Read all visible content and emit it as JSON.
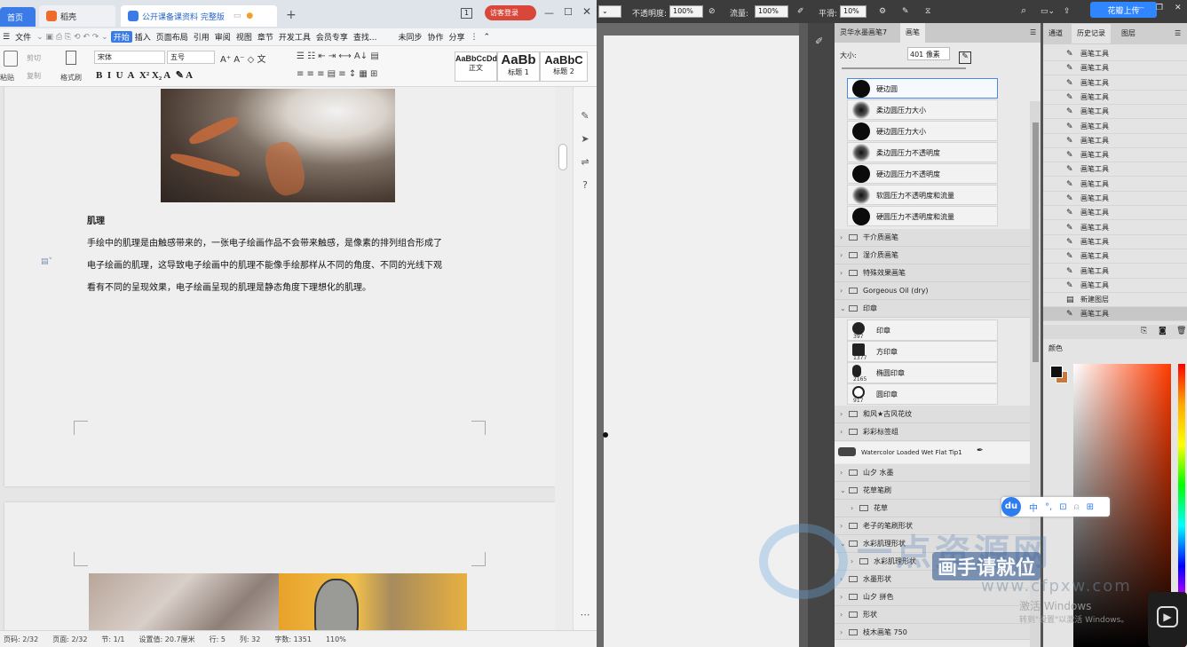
{
  "wps": {
    "tabs": [
      {
        "label": "首页"
      },
      {
        "label": "稻壳"
      },
      {
        "label": "公开课备课资料 完整版"
      }
    ],
    "page_indicator": "1",
    "login_label": "访客登录",
    "menu": [
      "文件",
      "开始",
      "插入",
      "页面布局",
      "引用",
      "审阅",
      "视图",
      "章节",
      "开发工具",
      "会员专享"
    ],
    "search_label": "查找...",
    "sync_label": "未同步",
    "collab_label": "协作",
    "share_label": "分享",
    "ribbon": {
      "paste_label": "粘贴",
      "cut_label": "剪切",
      "copy_label": "复制",
      "format_painter_label": "格式刷",
      "font_name": "宋体",
      "font_size": "五号",
      "styles": [
        {
          "preview": "AaBbCcDd",
          "caption": "正文"
        },
        {
          "preview": "AaBb",
          "caption": "标题 1"
        },
        {
          "preview": "AaBbC",
          "caption": "标题 2"
        }
      ]
    },
    "document": {
      "heading": "肌理",
      "lines": [
        "手绘中的肌理是由触感带来的，一张电子绘画作品不会带来触感，是像素的排列组合形成了",
        "电子绘画的肌理，这导致电子绘画中的肌理不能像手绘那样从不同的角度、不同的光线下观",
        "看有不同的呈现效果，电子绘画呈现的肌理是静态角度下理想化的肌理。"
      ]
    },
    "status": [
      "页码: 2/32",
      "页面: 2/32",
      "节: 1/1",
      "设置值: 20.7厘米",
      "行: 5",
      "列: 32",
      "字数: 1351",
      "110%"
    ]
  },
  "ps": {
    "options": {
      "opacity_label": "不透明度:",
      "opacity_value": "100%",
      "flow_label": "流量:",
      "flow_value": "100%",
      "smooth_label": "平滑:",
      "smooth_value": "10%"
    },
    "cloud_button": "花瓣上传",
    "brush_panel": {
      "tabs": [
        "灵华水墨画笔7",
        "画笔"
      ],
      "size_label": "大小:",
      "size_value": "401 像素",
      "brushes": [
        {
          "name": "硬边圆",
          "soft": false,
          "selected": true
        },
        {
          "name": "柔边圆压力大小",
          "soft": true,
          "selected": false
        },
        {
          "name": "硬边圆压力大小",
          "soft": false,
          "selected": false
        },
        {
          "name": "柔边圆压力不透明度",
          "soft": true,
          "selected": false
        },
        {
          "name": "硬边圆压力不透明度",
          "soft": false,
          "selected": false
        },
        {
          "name": "软圆压力不透明度和流量",
          "soft": true,
          "selected": false
        },
        {
          "name": "硬圆压力不透明度和流量",
          "soft": false,
          "selected": false
        }
      ],
      "folders_a": [
        "干介质画笔",
        "湿介质画笔",
        "特殊效果画笔",
        "Gorgeous Oil (dry)",
        "印章"
      ],
      "stamps": [
        {
          "name": "印章",
          "num": "397"
        },
        {
          "name": "方印章",
          "num": "1377"
        },
        {
          "name": "椭圆印章",
          "num": "2165"
        },
        {
          "name": "圆印章",
          "num": "917"
        }
      ],
      "folders_b": [
        "和风★古风花纹",
        "彩彩标签组"
      ],
      "watercolor": "Watercolor Loaded Wet Flat Tip1",
      "folders_c": [
        "山夕 水墨",
        "花草笔刷",
        "花草",
        "老子的笔刷形状",
        "水彩肌理形状",
        "水彩肌理形状",
        "水墨形状",
        "山夕 拼色",
        "形状",
        "枝木画笔 750"
      ]
    },
    "history": {
      "tabs": [
        "通道",
        "历史记录",
        "图层"
      ],
      "items": [
        "画笔工具",
        "画笔工具",
        "画笔工具",
        "画笔工具",
        "画笔工具",
        "画笔工具",
        "画笔工具",
        "画笔工具",
        "画笔工具",
        "画笔工具",
        "画笔工具",
        "画笔工具",
        "画笔工具",
        "画笔工具",
        "画笔工具",
        "画笔工具",
        "画笔工具",
        "新建图层",
        "画笔工具"
      ]
    },
    "color_tab": "颜色",
    "colors": {
      "foreground": "#111111",
      "background": "#c7783c"
    }
  },
  "overlays": {
    "ime": [
      "中",
      "°,"
    ],
    "ime_logo": "du",
    "watermark_title": "一点资源网",
    "watermark_sub": "画手请就位",
    "watermark_url": "www.cfpxw.com",
    "activate_title": "激活 Windows",
    "activate_sub": "转到\"设置\"以激活 Windows。"
  }
}
